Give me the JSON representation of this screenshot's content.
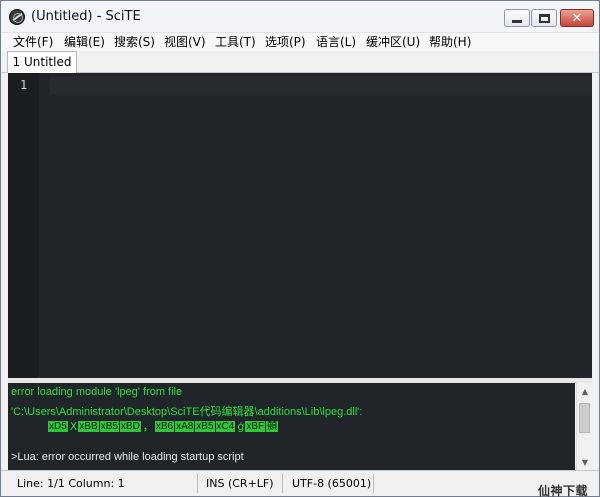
{
  "window": {
    "title": "(Untitled) - SciTE",
    "icon": "scite-app-icon",
    "close_glyph": "✕"
  },
  "menubar": {
    "items": [
      {
        "label": "文件(F)"
      },
      {
        "label": "编辑(E)"
      },
      {
        "label": "搜索(S)"
      },
      {
        "label": "视图(V)"
      },
      {
        "label": "工具(T)"
      },
      {
        "label": "选项(P)"
      },
      {
        "label": "语言(L)"
      },
      {
        "label": "缓冲区(U)"
      },
      {
        "label": "帮助(H)"
      }
    ]
  },
  "tabs": [
    {
      "label": "1 Untitled"
    }
  ],
  "editor": {
    "line_numbers": [
      "1"
    ],
    "background": "#22262a"
  },
  "output": {
    "lines": {
      "error_header": "error loading module 'lpeg' from file",
      "error_path": "'C:\\Users\\Administrator\\Desktop\\SciTE代码编辑器\\additions\\Lib\\lpeg.dll':",
      "hex_tokens": [
        "xD5",
        "X",
        "xBB",
        "xB5",
        "xBD",
        "，",
        "xB6",
        "xA8",
        "xB5",
        "xC4",
        "ģ",
        "xBF",
        "顤"
      ],
      "lua_error": ">Lua: error occurred while loading startup script"
    },
    "colors": {
      "text": "#33df41",
      "hex_bg": "#2ec73a"
    }
  },
  "statusbar": {
    "position": "Line: 1/1  Column: 1",
    "mode": "INS (CR+LF)",
    "encoding": "UTF-8 (65001)"
  },
  "watermark": "仙神下载网"
}
